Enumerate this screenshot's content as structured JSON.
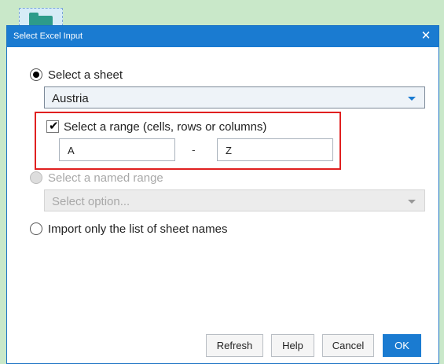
{
  "window": {
    "title": "Select Excel Input"
  },
  "options": {
    "select_sheet_label": "Select a sheet",
    "sheet_value": "Austria",
    "range_label": "Select a range (cells, rows or columns)",
    "range_from": "A",
    "range_separator": "-",
    "range_to": "Z",
    "named_range_label": "Select a named range",
    "named_range_placeholder": "Select option...",
    "sheet_names_label": "Import only the list of sheet names"
  },
  "buttons": {
    "refresh": "Refresh",
    "help": "Help",
    "cancel": "Cancel",
    "ok": "OK"
  },
  "icons": {
    "close": "✕",
    "check": "✔"
  },
  "colors": {
    "accent": "#1a7bd1",
    "highlight": "#e02020"
  }
}
